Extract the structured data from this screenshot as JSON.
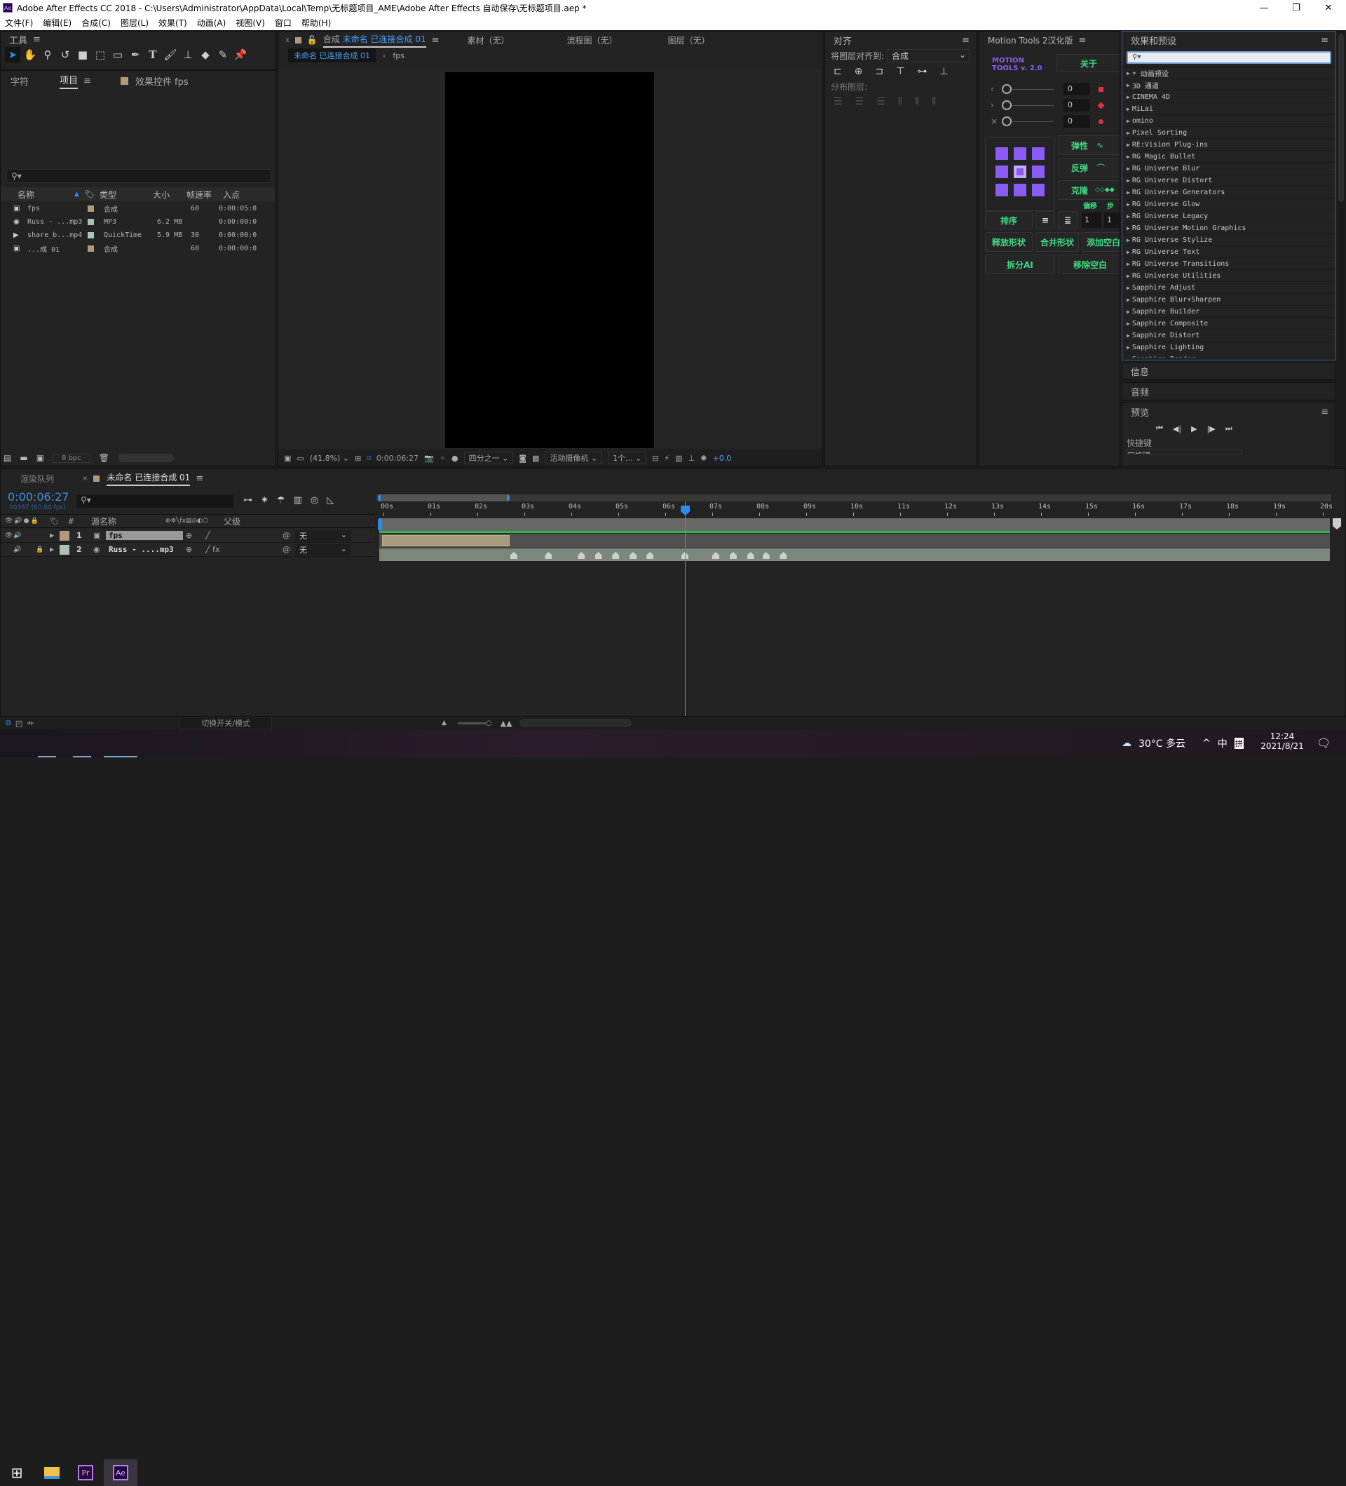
{
  "window": {
    "title": "Adobe After Effects CC 2018 - C:\\Users\\Administrator\\AppData\\Local\\Temp\\无标题项目_AME\\Adobe After Effects 自动保存\\无标题项目.aep *",
    "app_icon": "Ae",
    "minimize": "—",
    "restore": "❐",
    "close": "✕"
  },
  "menu": [
    "文件(F)",
    "编辑(E)",
    "合成(C)",
    "图层(L)",
    "效果(T)",
    "动画(A)",
    "视图(V)",
    "窗口",
    "帮助(H)"
  ],
  "tools_panel": {
    "title": "工具",
    "tools": [
      "selection-tool",
      "hand-tool",
      "zoom-tool",
      "rotate-tool",
      "camera-tool",
      "pan-behind-tool",
      "rectangle-tool",
      "pen-tool",
      "type-tool",
      "brush-tool",
      "clone-stamp-tool",
      "eraser-tool",
      "roto-brush-tool",
      "puppet-pin-tool"
    ]
  },
  "project_panel": {
    "tabs": [
      "字符",
      "项目",
      "效果控件 fps"
    ],
    "search_placeholder": "",
    "columns": [
      "名称",
      "类型",
      "大小",
      "帧速率",
      "入点"
    ],
    "rows": [
      {
        "name": "fps",
        "type": "合成",
        "size": "",
        "fps": "60",
        "in": "0:00:05:0",
        "color": "#b09a7a",
        "icon": "composition"
      },
      {
        "name": "Russ - ...mp3",
        "type": "MP3",
        "size": "6.2 MB",
        "fps": "",
        "in": "0:00:00:0",
        "color": "#a8c4b0",
        "icon": "audio"
      },
      {
        "name": "share_b...mp4",
        "type": "QuickTime",
        "size": "5.9 MB",
        "fps": "30",
        "in": "0:00:00:0",
        "color": "#a8c8c8",
        "icon": "video"
      },
      {
        "name": "...成 01",
        "type": "合成",
        "size": "",
        "fps": "60",
        "in": "0:00:00:0",
        "color": "#b09a7a",
        "icon": "composition"
      }
    ],
    "bpc": "8 bpc"
  },
  "comp_viewer": {
    "tabs": [
      {
        "prefix": "合成",
        "name": "未命名 已连接合成 01"
      },
      {
        "name": "素材（无）"
      },
      {
        "name": "流程图（无）"
      },
      {
        "name": "图层（无）"
      }
    ],
    "breadcrumb": [
      "未命名 已连接合成 01",
      "fps"
    ],
    "zoom": "(41.8%)",
    "timecode": "0:00:06:27",
    "resolution": "四分之一",
    "camera": "活动摄像机",
    "views": "1个...",
    "exposure": "+0.0"
  },
  "align_panel": {
    "title": "对齐",
    "align_to_label": "将图层对齐到:",
    "align_to_value": "合成",
    "distribute_label": "分布图层:"
  },
  "motion_tools": {
    "title": "Motion Tools 2汉化版",
    "logo_line1": "MOTION",
    "logo_line2": "TOOLS v. 2.0",
    "about": "关于",
    "sliders": [
      {
        "icon": "‹",
        "value": "0"
      },
      {
        "icon": "›",
        "value": "0"
      },
      {
        "icon": "×",
        "value": "0"
      }
    ],
    "buttons": {
      "elastic": "弹性",
      "bounce": "反弹",
      "clone": "克隆",
      "offset": "偏移",
      "step": "步",
      "sort": "排序",
      "explode": "释放形状",
      "merge": "合并形状",
      "add_null": "添加空白",
      "split_ai": "拆分AI",
      "remove_null": "移除空白"
    },
    "offset_value": "1",
    "step_value": "1",
    "accent": "#3ddc84",
    "purple": "#8a5cf5"
  },
  "effects_panel": {
    "title": "效果和预设",
    "search_value": "",
    "items": [
      "* 动画预设",
      "3D 通道",
      "CINEMA 4D",
      "MiLai",
      "omino",
      "Pixel Sorting",
      "RE:Vision Plug-ins",
      "RG Magic Bullet",
      "RG Universe Blur",
      "RG Universe Distort",
      "RG Universe Generators",
      "RG Universe Glow",
      "RG Universe Legacy",
      "RG Universe Motion Graphics",
      "RG Universe Stylize",
      "RG Universe Text",
      "RG Universe Transitions",
      "RG Universe Utilities",
      "Sapphire Adjust",
      "Sapphire Blur+Sharpen",
      "Sapphire Builder",
      "Sapphire Composite",
      "Sapphire Distort",
      "Sapphire Lighting",
      "Sapphire Render"
    ]
  },
  "side_panels": {
    "info": "信息",
    "audio": "音频",
    "preview": "预览",
    "shortcut_label": "快捷键",
    "shortcut_value": "空格键"
  },
  "timeline": {
    "tabs": [
      "渲染队列",
      "未命名 已连接合成 01"
    ],
    "timecode": "0:00:06:27",
    "frame_info": "00387 (60.00 fps)",
    "columns": {
      "num": "#",
      "source": "源名称",
      "parent": "父级"
    },
    "layers": [
      {
        "num": "1",
        "name": "fps",
        "color": "#b09a7a",
        "parent": "无",
        "icon": "composition"
      },
      {
        "num": "2",
        "name": "Russ - ....mp3",
        "color": "#a8c4b0",
        "parent": "无",
        "icon": "audio"
      }
    ],
    "ruler": [
      "00s",
      "01s",
      "02s",
      "03s",
      "04s",
      "05s",
      "06s",
      "07s",
      "08s",
      "09s",
      "10s",
      "11s",
      "12s",
      "13s",
      "14s",
      "15s",
      "16s",
      "17s",
      "18s",
      "19s",
      "20s"
    ],
    "playhead_seconds": 6.45,
    "duration_seconds": 20,
    "layer1_bar_end_seconds": 2.72,
    "audio_markers_seconds": [
      2.73,
      3.47,
      4.17,
      4.53,
      4.9,
      5.27,
      5.63,
      6.37,
      7.03,
      7.4,
      7.77,
      8.1,
      8.47
    ],
    "footer_toggle": "切换开关/模式"
  },
  "taskbar": {
    "weather": "30°C 多云",
    "ime1": "中",
    "ime2": "拼",
    "time": "12:24",
    "date": "2021/8/21",
    "apps": [
      "file-explorer",
      "Pr",
      "Ae"
    ]
  }
}
